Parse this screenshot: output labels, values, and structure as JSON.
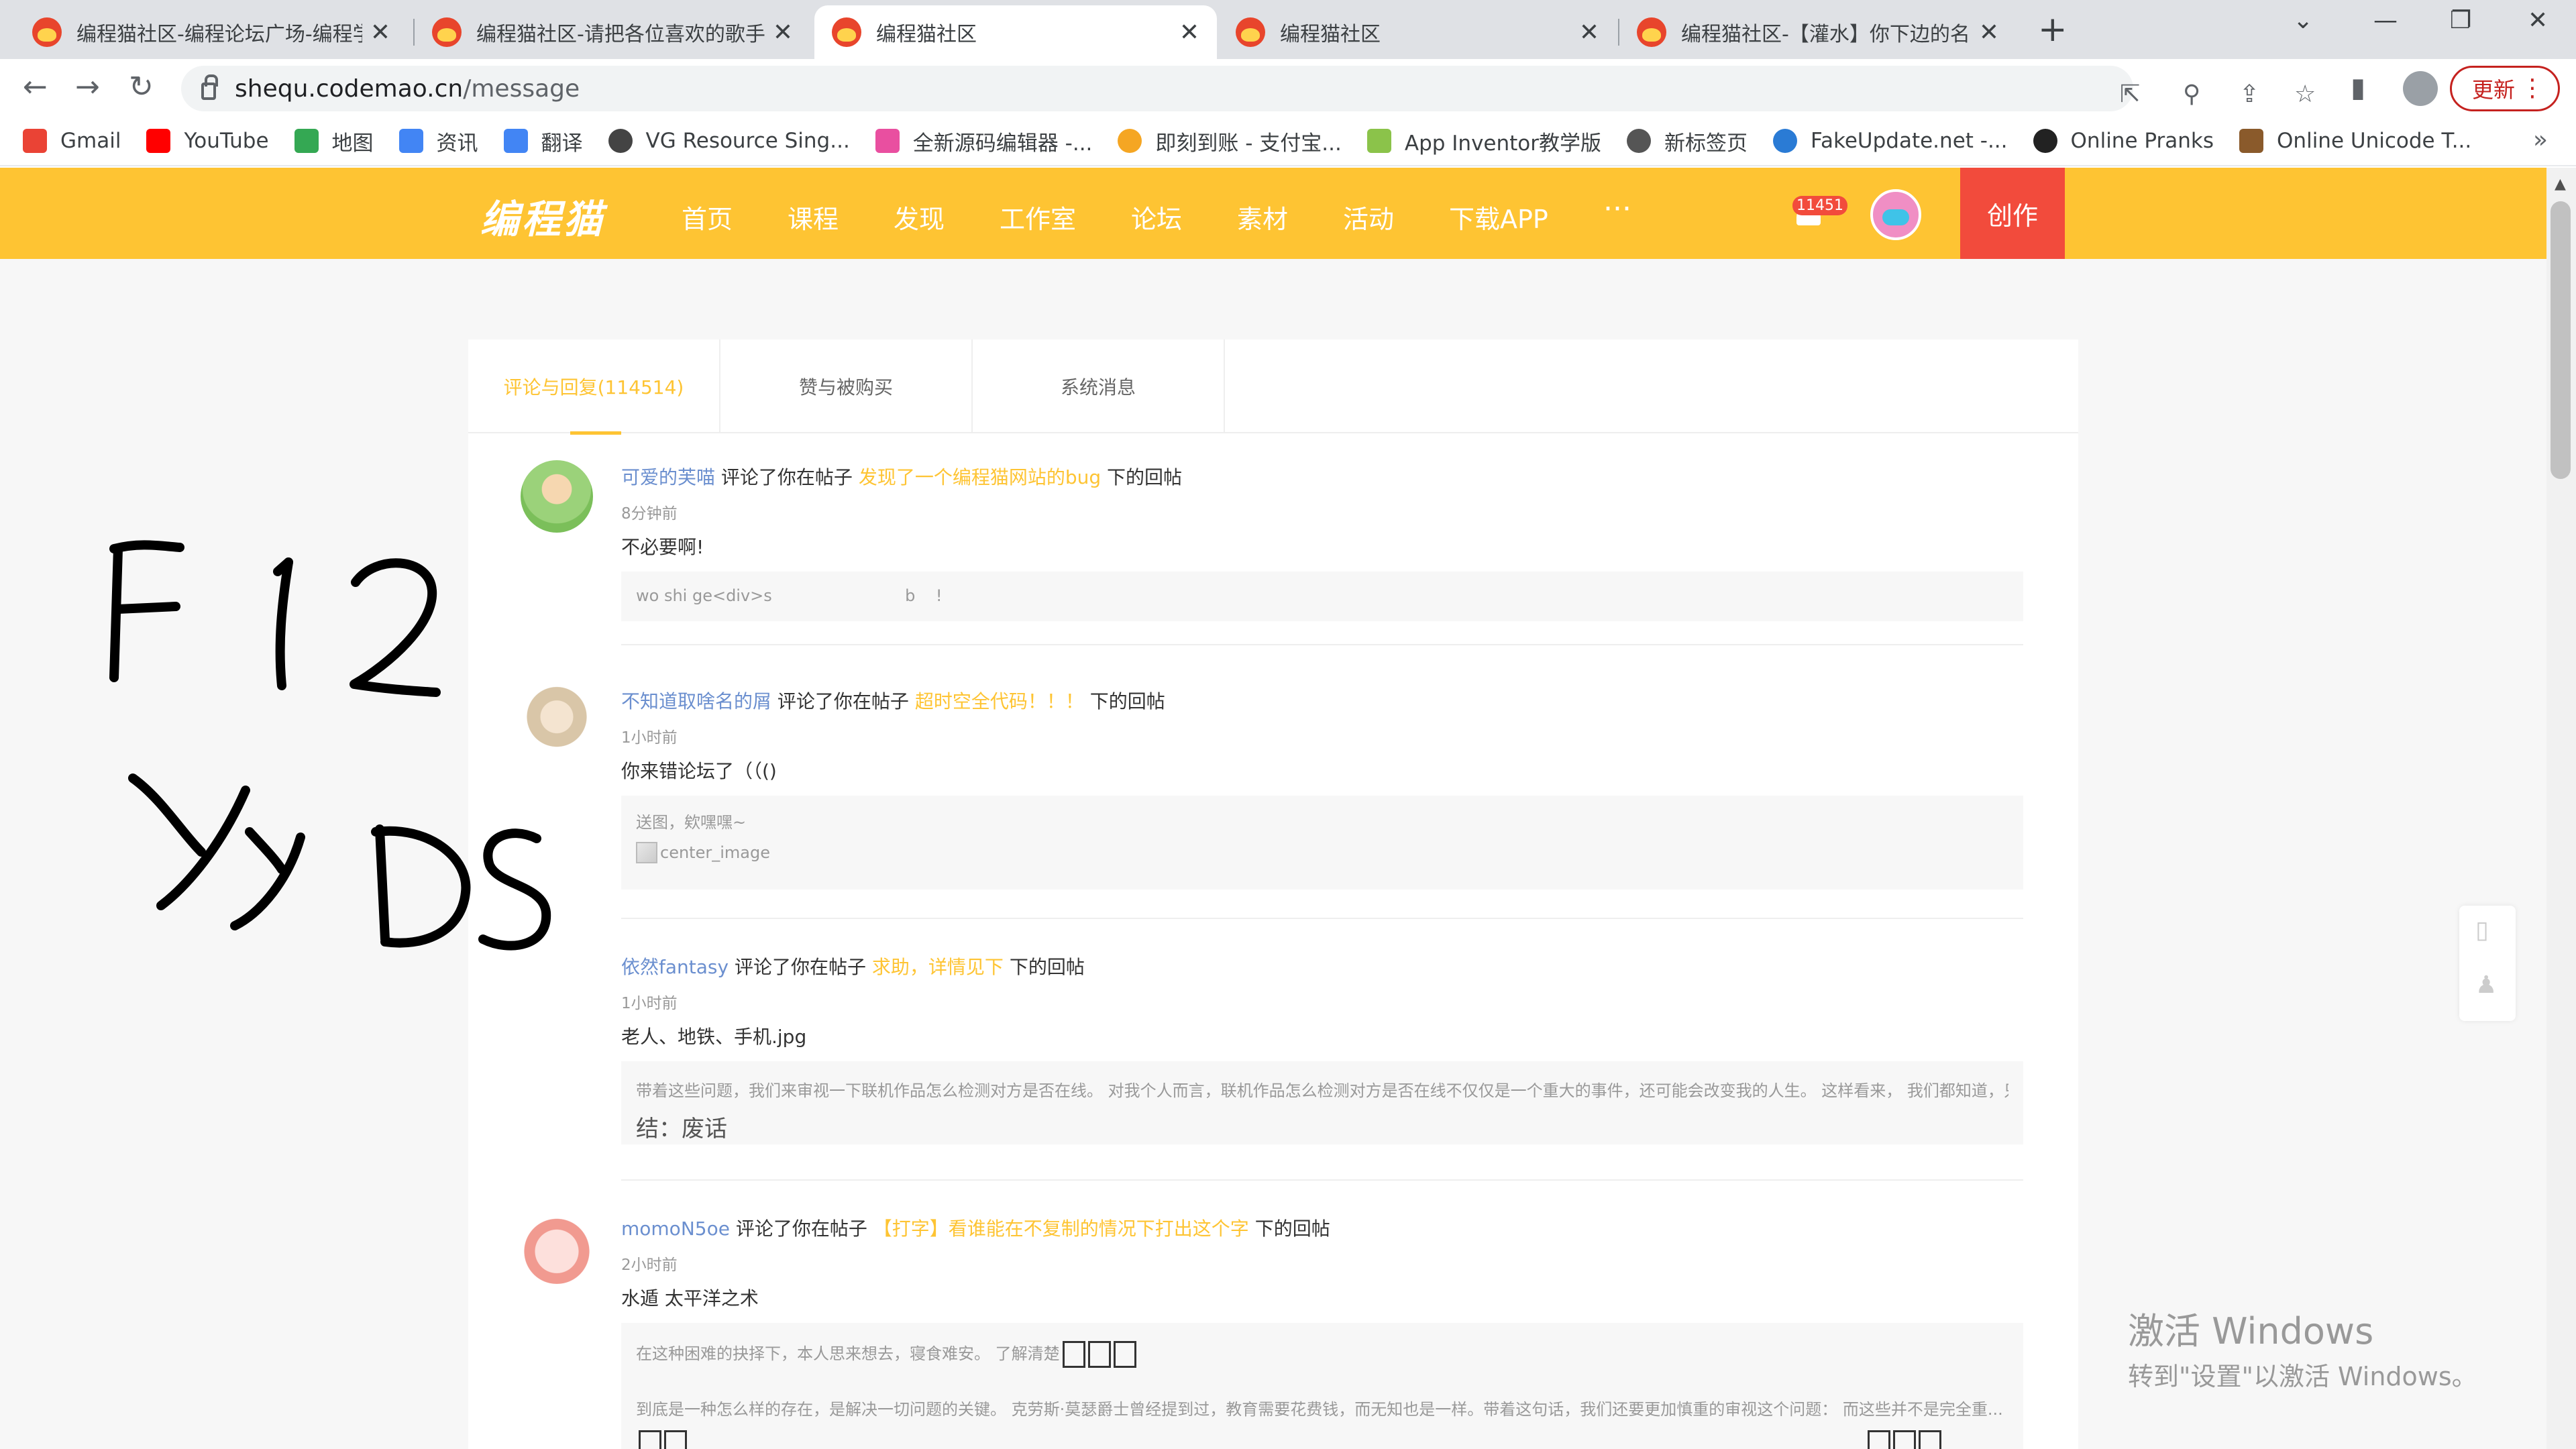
{
  "browser": {
    "tabs": [
      {
        "title": "编程猫社区-编程论坛广场-编程学"
      },
      {
        "title": "编程猫社区-请把各位喜欢的歌手"
      },
      {
        "title": "编程猫社区"
      },
      {
        "title": "编程猫社区"
      },
      {
        "title": "编程猫社区-【灌水】你下边的名"
      }
    ],
    "new_tab": "+",
    "url_host": "shequ.codemao.cn",
    "url_path": "/message",
    "update_label": "更新",
    "bookmarks": [
      {
        "label": "Gmail",
        "color": "#ea4335"
      },
      {
        "label": "YouTube",
        "color": "#ff0000"
      },
      {
        "label": "地图",
        "color": "#34a853"
      },
      {
        "label": "资讯",
        "color": "#4285f4"
      },
      {
        "label": "翻译",
        "color": "#4285f4"
      },
      {
        "label": "VG Resource Sing...",
        "color": "#444444"
      },
      {
        "label": "全新源码编辑器 -...",
        "color": "#e94fa0"
      },
      {
        "label": "即刻到账 - 支付宝...",
        "color": "#f5a623"
      },
      {
        "label": "App Inventor教学版",
        "color": "#8bc34a"
      },
      {
        "label": "新标签页",
        "color": "#555555"
      },
      {
        "label": "FakeUpdate.net -...",
        "color": "#2a7bd5"
      },
      {
        "label": "Online Pranks",
        "color": "#222222"
      },
      {
        "label": "Online Unicode T...",
        "color": "#8a5a2b"
      }
    ]
  },
  "site": {
    "logo": "编程猫",
    "nav": [
      "首页",
      "课程",
      "发现",
      "工作室",
      "论坛",
      "素材",
      "活动",
      "下载APP"
    ],
    "nav_more": "···",
    "notification_count": "11451",
    "create_label": "创作",
    "accent": "#fec433",
    "create_color": "#f24b3c"
  },
  "messages_page": {
    "tabs": [
      "评论与回复(114514)",
      "赞与被购买",
      "系统消息"
    ],
    "items": [
      {
        "user": "可爱的芙喵",
        "action": "评论了你在帖子",
        "post": "发现了一个编程猫网站的bug",
        "suffix": "下的回帖",
        "time": "8分钟前",
        "text": "不必要啊!",
        "quote": [
          "wo shi ge<div>s                          b    !"
        ]
      },
      {
        "user": "不知道取啥名的屑",
        "action": "评论了你在帖子",
        "post": "超时空全代码！！！",
        "suffix": "下的回帖",
        "time": "1小时前",
        "text": "你来错论坛了（（()",
        "quote": [
          "送图，欸嘿嘿~"
        ],
        "image_alt": "center_image"
      },
      {
        "user": "依然fantasy",
        "action": "评论了你在帖子",
        "post": "求助，详情见下",
        "suffix": "下的回帖",
        "time": "1小时前",
        "text": "老人、地铁、手机.jpg",
        "quote": [
          "带着这些问题，我们来审视一下联机作品怎么检测对方是否在线。 对我个人而言，联机作品怎么检测对方是否在线不仅仅是一个重大的事件，还可能会改变我的人生。 这样看来， 我们都知道，只要",
          "结：废话"
        ]
      },
      {
        "user": "momoN5oe",
        "action": "评论了你在帖子",
        "post": "【打字】看谁能在不复制的情况下打出这个字",
        "suffix": "下的回帖",
        "time": "2小时前",
        "text": "水遁 太平洋之术",
        "quote": [
          "在这种困难的抉择下，本人思来想去，寝食难安。 了解清楚",
          "到底是一种怎么样的存在，是解决一切问题的关键。 克劳斯·莫瑟爵士曾经提到过，教育需要花费钱，而无知也是一样。带着这句话，我们还要更加慎重的审视这个问题： 而这些并不是完全重..."
        ]
      }
    ]
  },
  "handwriting": [
    "F 12",
    "YyDS"
  ],
  "windows_activation": {
    "title": "激活 Windows",
    "subtitle": "转到\"设置\"以激活 Windows。"
  }
}
